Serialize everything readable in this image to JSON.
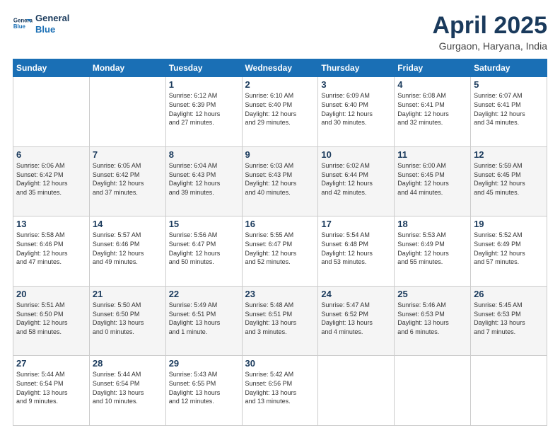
{
  "logo": {
    "line1": "General",
    "line2": "Blue"
  },
  "title": "April 2025",
  "subtitle": "Gurgaon, Haryana, India",
  "days_header": [
    "Sunday",
    "Monday",
    "Tuesday",
    "Wednesday",
    "Thursday",
    "Friday",
    "Saturday"
  ],
  "weeks": [
    [
      {
        "num": "",
        "info": ""
      },
      {
        "num": "",
        "info": ""
      },
      {
        "num": "1",
        "info": "Sunrise: 6:12 AM\nSunset: 6:39 PM\nDaylight: 12 hours\nand 27 minutes."
      },
      {
        "num": "2",
        "info": "Sunrise: 6:10 AM\nSunset: 6:40 PM\nDaylight: 12 hours\nand 29 minutes."
      },
      {
        "num": "3",
        "info": "Sunrise: 6:09 AM\nSunset: 6:40 PM\nDaylight: 12 hours\nand 30 minutes."
      },
      {
        "num": "4",
        "info": "Sunrise: 6:08 AM\nSunset: 6:41 PM\nDaylight: 12 hours\nand 32 minutes."
      },
      {
        "num": "5",
        "info": "Sunrise: 6:07 AM\nSunset: 6:41 PM\nDaylight: 12 hours\nand 34 minutes."
      }
    ],
    [
      {
        "num": "6",
        "info": "Sunrise: 6:06 AM\nSunset: 6:42 PM\nDaylight: 12 hours\nand 35 minutes."
      },
      {
        "num": "7",
        "info": "Sunrise: 6:05 AM\nSunset: 6:42 PM\nDaylight: 12 hours\nand 37 minutes."
      },
      {
        "num": "8",
        "info": "Sunrise: 6:04 AM\nSunset: 6:43 PM\nDaylight: 12 hours\nand 39 minutes."
      },
      {
        "num": "9",
        "info": "Sunrise: 6:03 AM\nSunset: 6:43 PM\nDaylight: 12 hours\nand 40 minutes."
      },
      {
        "num": "10",
        "info": "Sunrise: 6:02 AM\nSunset: 6:44 PM\nDaylight: 12 hours\nand 42 minutes."
      },
      {
        "num": "11",
        "info": "Sunrise: 6:00 AM\nSunset: 6:45 PM\nDaylight: 12 hours\nand 44 minutes."
      },
      {
        "num": "12",
        "info": "Sunrise: 5:59 AM\nSunset: 6:45 PM\nDaylight: 12 hours\nand 45 minutes."
      }
    ],
    [
      {
        "num": "13",
        "info": "Sunrise: 5:58 AM\nSunset: 6:46 PM\nDaylight: 12 hours\nand 47 minutes."
      },
      {
        "num": "14",
        "info": "Sunrise: 5:57 AM\nSunset: 6:46 PM\nDaylight: 12 hours\nand 49 minutes."
      },
      {
        "num": "15",
        "info": "Sunrise: 5:56 AM\nSunset: 6:47 PM\nDaylight: 12 hours\nand 50 minutes."
      },
      {
        "num": "16",
        "info": "Sunrise: 5:55 AM\nSunset: 6:47 PM\nDaylight: 12 hours\nand 52 minutes."
      },
      {
        "num": "17",
        "info": "Sunrise: 5:54 AM\nSunset: 6:48 PM\nDaylight: 12 hours\nand 53 minutes."
      },
      {
        "num": "18",
        "info": "Sunrise: 5:53 AM\nSunset: 6:49 PM\nDaylight: 12 hours\nand 55 minutes."
      },
      {
        "num": "19",
        "info": "Sunrise: 5:52 AM\nSunset: 6:49 PM\nDaylight: 12 hours\nand 57 minutes."
      }
    ],
    [
      {
        "num": "20",
        "info": "Sunrise: 5:51 AM\nSunset: 6:50 PM\nDaylight: 12 hours\nand 58 minutes."
      },
      {
        "num": "21",
        "info": "Sunrise: 5:50 AM\nSunset: 6:50 PM\nDaylight: 13 hours\nand 0 minutes."
      },
      {
        "num": "22",
        "info": "Sunrise: 5:49 AM\nSunset: 6:51 PM\nDaylight: 13 hours\nand 1 minute."
      },
      {
        "num": "23",
        "info": "Sunrise: 5:48 AM\nSunset: 6:51 PM\nDaylight: 13 hours\nand 3 minutes."
      },
      {
        "num": "24",
        "info": "Sunrise: 5:47 AM\nSunset: 6:52 PM\nDaylight: 13 hours\nand 4 minutes."
      },
      {
        "num": "25",
        "info": "Sunrise: 5:46 AM\nSunset: 6:53 PM\nDaylight: 13 hours\nand 6 minutes."
      },
      {
        "num": "26",
        "info": "Sunrise: 5:45 AM\nSunset: 6:53 PM\nDaylight: 13 hours\nand 7 minutes."
      }
    ],
    [
      {
        "num": "27",
        "info": "Sunrise: 5:44 AM\nSunset: 6:54 PM\nDaylight: 13 hours\nand 9 minutes."
      },
      {
        "num": "28",
        "info": "Sunrise: 5:44 AM\nSunset: 6:54 PM\nDaylight: 13 hours\nand 10 minutes."
      },
      {
        "num": "29",
        "info": "Sunrise: 5:43 AM\nSunset: 6:55 PM\nDaylight: 13 hours\nand 12 minutes."
      },
      {
        "num": "30",
        "info": "Sunrise: 5:42 AM\nSunset: 6:56 PM\nDaylight: 13 hours\nand 13 minutes."
      },
      {
        "num": "",
        "info": ""
      },
      {
        "num": "",
        "info": ""
      },
      {
        "num": "",
        "info": ""
      }
    ]
  ]
}
